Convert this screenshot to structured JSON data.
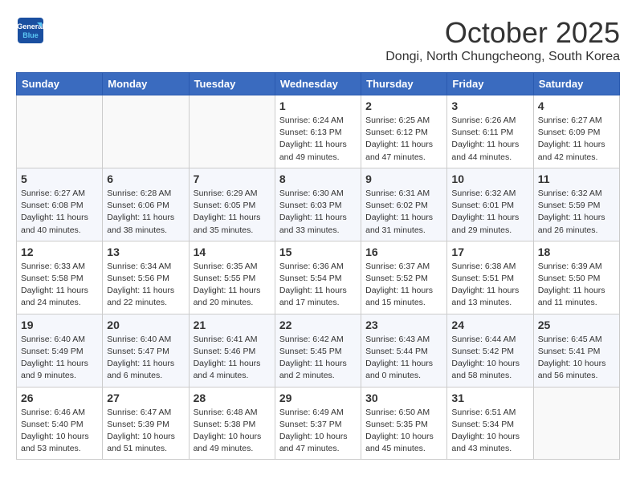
{
  "logo": {
    "line1": "General",
    "line2": "Blue"
  },
  "title": "October 2025",
  "subtitle": "Dongi, North Chungcheong, South Korea",
  "days_of_week": [
    "Sunday",
    "Monday",
    "Tuesday",
    "Wednesday",
    "Thursday",
    "Friday",
    "Saturday"
  ],
  "weeks": [
    [
      {
        "day": "",
        "info": ""
      },
      {
        "day": "",
        "info": ""
      },
      {
        "day": "",
        "info": ""
      },
      {
        "day": "1",
        "info": "Sunrise: 6:24 AM\nSunset: 6:13 PM\nDaylight: 11 hours\nand 49 minutes."
      },
      {
        "day": "2",
        "info": "Sunrise: 6:25 AM\nSunset: 6:12 PM\nDaylight: 11 hours\nand 47 minutes."
      },
      {
        "day": "3",
        "info": "Sunrise: 6:26 AM\nSunset: 6:11 PM\nDaylight: 11 hours\nand 44 minutes."
      },
      {
        "day": "4",
        "info": "Sunrise: 6:27 AM\nSunset: 6:09 PM\nDaylight: 11 hours\nand 42 minutes."
      }
    ],
    [
      {
        "day": "5",
        "info": "Sunrise: 6:27 AM\nSunset: 6:08 PM\nDaylight: 11 hours\nand 40 minutes."
      },
      {
        "day": "6",
        "info": "Sunrise: 6:28 AM\nSunset: 6:06 PM\nDaylight: 11 hours\nand 38 minutes."
      },
      {
        "day": "7",
        "info": "Sunrise: 6:29 AM\nSunset: 6:05 PM\nDaylight: 11 hours\nand 35 minutes."
      },
      {
        "day": "8",
        "info": "Sunrise: 6:30 AM\nSunset: 6:03 PM\nDaylight: 11 hours\nand 33 minutes."
      },
      {
        "day": "9",
        "info": "Sunrise: 6:31 AM\nSunset: 6:02 PM\nDaylight: 11 hours\nand 31 minutes."
      },
      {
        "day": "10",
        "info": "Sunrise: 6:32 AM\nSunset: 6:01 PM\nDaylight: 11 hours\nand 29 minutes."
      },
      {
        "day": "11",
        "info": "Sunrise: 6:32 AM\nSunset: 5:59 PM\nDaylight: 11 hours\nand 26 minutes."
      }
    ],
    [
      {
        "day": "12",
        "info": "Sunrise: 6:33 AM\nSunset: 5:58 PM\nDaylight: 11 hours\nand 24 minutes."
      },
      {
        "day": "13",
        "info": "Sunrise: 6:34 AM\nSunset: 5:56 PM\nDaylight: 11 hours\nand 22 minutes."
      },
      {
        "day": "14",
        "info": "Sunrise: 6:35 AM\nSunset: 5:55 PM\nDaylight: 11 hours\nand 20 minutes."
      },
      {
        "day": "15",
        "info": "Sunrise: 6:36 AM\nSunset: 5:54 PM\nDaylight: 11 hours\nand 17 minutes."
      },
      {
        "day": "16",
        "info": "Sunrise: 6:37 AM\nSunset: 5:52 PM\nDaylight: 11 hours\nand 15 minutes."
      },
      {
        "day": "17",
        "info": "Sunrise: 6:38 AM\nSunset: 5:51 PM\nDaylight: 11 hours\nand 13 minutes."
      },
      {
        "day": "18",
        "info": "Sunrise: 6:39 AM\nSunset: 5:50 PM\nDaylight: 11 hours\nand 11 minutes."
      }
    ],
    [
      {
        "day": "19",
        "info": "Sunrise: 6:40 AM\nSunset: 5:49 PM\nDaylight: 11 hours\nand 9 minutes."
      },
      {
        "day": "20",
        "info": "Sunrise: 6:40 AM\nSunset: 5:47 PM\nDaylight: 11 hours\nand 6 minutes."
      },
      {
        "day": "21",
        "info": "Sunrise: 6:41 AM\nSunset: 5:46 PM\nDaylight: 11 hours\nand 4 minutes."
      },
      {
        "day": "22",
        "info": "Sunrise: 6:42 AM\nSunset: 5:45 PM\nDaylight: 11 hours\nand 2 minutes."
      },
      {
        "day": "23",
        "info": "Sunrise: 6:43 AM\nSunset: 5:44 PM\nDaylight: 11 hours\nand 0 minutes."
      },
      {
        "day": "24",
        "info": "Sunrise: 6:44 AM\nSunset: 5:42 PM\nDaylight: 10 hours\nand 58 minutes."
      },
      {
        "day": "25",
        "info": "Sunrise: 6:45 AM\nSunset: 5:41 PM\nDaylight: 10 hours\nand 56 minutes."
      }
    ],
    [
      {
        "day": "26",
        "info": "Sunrise: 6:46 AM\nSunset: 5:40 PM\nDaylight: 10 hours\nand 53 minutes."
      },
      {
        "day": "27",
        "info": "Sunrise: 6:47 AM\nSunset: 5:39 PM\nDaylight: 10 hours\nand 51 minutes."
      },
      {
        "day": "28",
        "info": "Sunrise: 6:48 AM\nSunset: 5:38 PM\nDaylight: 10 hours\nand 49 minutes."
      },
      {
        "day": "29",
        "info": "Sunrise: 6:49 AM\nSunset: 5:37 PM\nDaylight: 10 hours\nand 47 minutes."
      },
      {
        "day": "30",
        "info": "Sunrise: 6:50 AM\nSunset: 5:35 PM\nDaylight: 10 hours\nand 45 minutes."
      },
      {
        "day": "31",
        "info": "Sunrise: 6:51 AM\nSunset: 5:34 PM\nDaylight: 10 hours\nand 43 minutes."
      },
      {
        "day": "",
        "info": ""
      }
    ]
  ]
}
